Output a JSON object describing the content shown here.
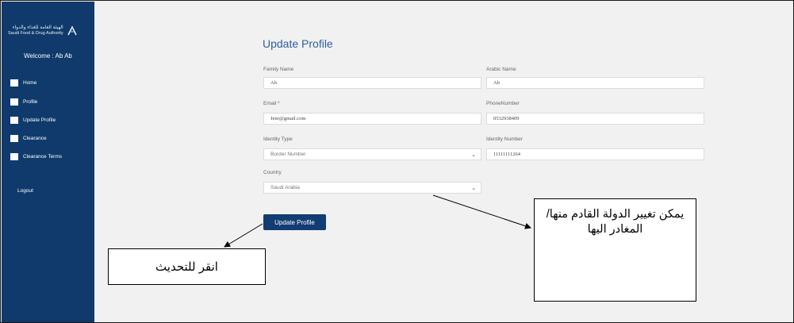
{
  "sidebar": {
    "logo_ar": "الهيئة العامة للغذاء والدواء",
    "logo_en": "Saudi Food & Drug Authority",
    "welcome": "Welcome : Ab Ab",
    "items": [
      {
        "label": "Home",
        "icon": "book-icon"
      },
      {
        "label": "Profile",
        "icon": "book-icon"
      },
      {
        "label": "Update Profile",
        "icon": "book-icon"
      },
      {
        "label": "Clearance",
        "icon": "book-icon"
      },
      {
        "label": "Clearance Terms",
        "icon": "book-icon"
      }
    ],
    "logout": "Logout"
  },
  "main": {
    "title": "Update Profile",
    "family_name": {
      "label": "Family Name",
      "value": "Ab"
    },
    "arabic_name": {
      "label": "Arabic Name",
      "value": "Ab"
    },
    "email": {
      "label": "Email *",
      "value": "Jenr@gmail.com"
    },
    "phone": {
      "label": "PhoneNumber",
      "value": "0532938409"
    },
    "identity_type": {
      "label": "Identity Type",
      "value": "Border Number"
    },
    "identity_number": {
      "label": "Identity Number",
      "value": "11111111264"
    },
    "country": {
      "label": "Country",
      "value": "Saudi Arabia"
    },
    "update_button": "Update Profile"
  },
  "annotations": {
    "country_note": "يمكن تغيير الدولة القادم منها/ المغادر اليها",
    "update_note": "انقر للتحديث"
  },
  "colors": {
    "sidebar": "#0f3a6b",
    "title": "#2f5f9e",
    "button": "#123c73"
  }
}
